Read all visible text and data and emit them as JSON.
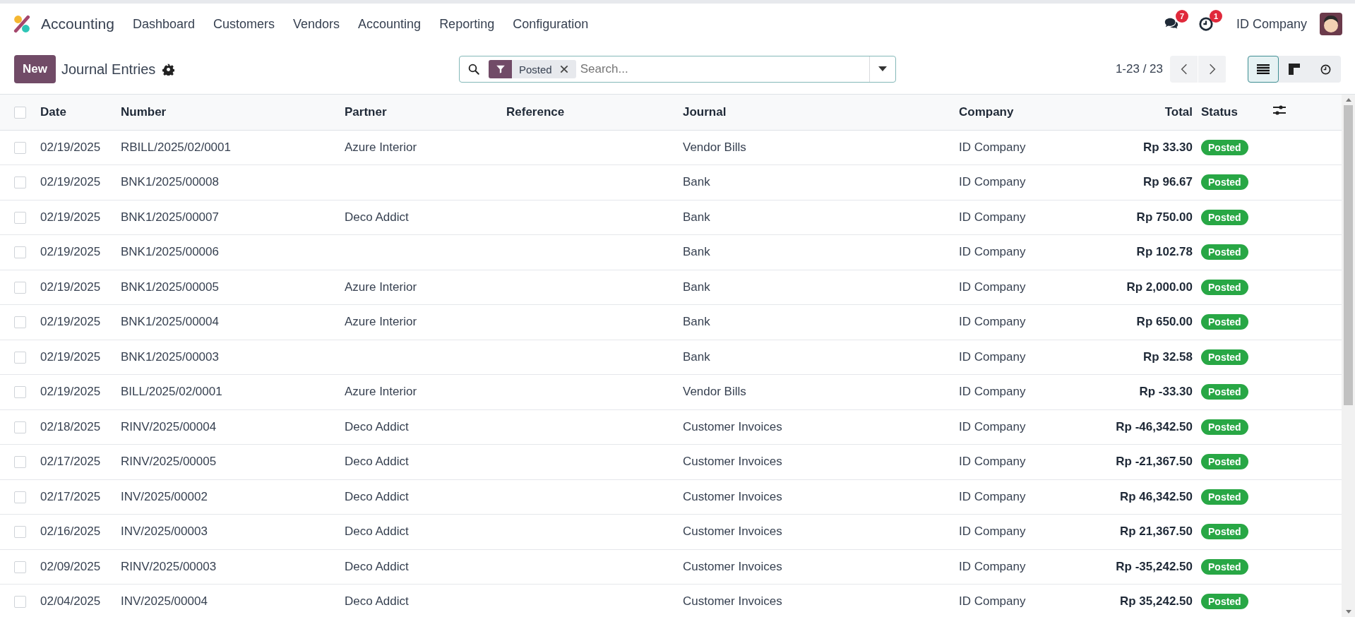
{
  "navbar": {
    "app_name": "Accounting",
    "menu": [
      "Dashboard",
      "Customers",
      "Vendors",
      "Accounting",
      "Reporting",
      "Configuration"
    ],
    "messages_count": "7",
    "activities_count": "1",
    "company": "ID Company"
  },
  "control_panel": {
    "new_button": "New",
    "title": "Journal Entries",
    "search": {
      "facet": "Posted",
      "placeholder": "Search..."
    },
    "pager": "1-23 / 23",
    "views": [
      {
        "kind": "list",
        "selected": true
      },
      {
        "kind": "kanban",
        "selected": false
      },
      {
        "kind": "activity",
        "selected": false
      }
    ]
  },
  "table": {
    "select_all_checked": false,
    "columns": [
      "Date",
      "Number",
      "Partner",
      "Reference",
      "Journal",
      "Company",
      "Total",
      "Status"
    ],
    "rows": [
      {
        "selected": false,
        "date": "02/19/2025",
        "number": "RBILL/2025/02/0001",
        "partner": "Azure Interior",
        "journal": "Vendor Bills",
        "company": "ID Company",
        "total": "Rp 33.30",
        "status": "Posted"
      },
      {
        "selected": false,
        "date": "02/19/2025",
        "number": "BNK1/2025/00008",
        "journal": "Bank",
        "company": "ID Company",
        "total": "Rp 96.67",
        "status": "Posted"
      },
      {
        "selected": false,
        "date": "02/19/2025",
        "number": "BNK1/2025/00007",
        "partner": "Deco Addict",
        "journal": "Bank",
        "company": "ID Company",
        "total": "Rp 750.00",
        "status": "Posted"
      },
      {
        "selected": false,
        "date": "02/19/2025",
        "number": "BNK1/2025/00006",
        "journal": "Bank",
        "company": "ID Company",
        "total": "Rp 102.78",
        "status": "Posted"
      },
      {
        "selected": false,
        "date": "02/19/2025",
        "number": "BNK1/2025/00005",
        "partner": "Azure Interior",
        "journal": "Bank",
        "company": "ID Company",
        "total": "Rp 2,000.00",
        "status": "Posted"
      },
      {
        "selected": false,
        "date": "02/19/2025",
        "number": "BNK1/2025/00004",
        "partner": "Azure Interior",
        "journal": "Bank",
        "company": "ID Company",
        "total": "Rp 650.00",
        "status": "Posted"
      },
      {
        "selected": false,
        "date": "02/19/2025",
        "number": "BNK1/2025/00003",
        "journal": "Bank",
        "company": "ID Company",
        "total": "Rp 32.58",
        "status": "Posted"
      },
      {
        "selected": false,
        "date": "02/19/2025",
        "number": "BILL/2025/02/0001",
        "partner": "Azure Interior",
        "journal": "Vendor Bills",
        "company": "ID Company",
        "total": "Rp -33.30",
        "status": "Posted"
      },
      {
        "selected": false,
        "date": "02/18/2025",
        "number": "RINV/2025/00004",
        "partner": "Deco Addict",
        "journal": "Customer Invoices",
        "company": "ID Company",
        "total": "Rp -46,342.50",
        "status": "Posted"
      },
      {
        "selected": false,
        "date": "02/17/2025",
        "number": "RINV/2025/00005",
        "partner": "Deco Addict",
        "journal": "Customer Invoices",
        "company": "ID Company",
        "total": "Rp -21,367.50",
        "status": "Posted"
      },
      {
        "selected": false,
        "date": "02/17/2025",
        "number": "INV/2025/00002",
        "partner": "Deco Addict",
        "journal": "Customer Invoices",
        "company": "ID Company",
        "total": "Rp 46,342.50",
        "status": "Posted"
      },
      {
        "selected": false,
        "date": "02/16/2025",
        "number": "INV/2025/00003",
        "partner": "Deco Addict",
        "journal": "Customer Invoices",
        "company": "ID Company",
        "total": "Rp 21,367.50",
        "status": "Posted"
      },
      {
        "selected": false,
        "date": "02/09/2025",
        "number": "RINV/2025/00003",
        "partner": "Deco Addict",
        "journal": "Customer Invoices",
        "company": "ID Company",
        "total": "Rp -35,242.50",
        "status": "Posted"
      },
      {
        "selected": false,
        "date": "02/04/2025",
        "number": "INV/2025/00004",
        "partner": "Deco Addict",
        "journal": "Customer Invoices",
        "company": "ID Company",
        "total": "Rp 35,242.50",
        "status": "Posted"
      }
    ]
  }
}
